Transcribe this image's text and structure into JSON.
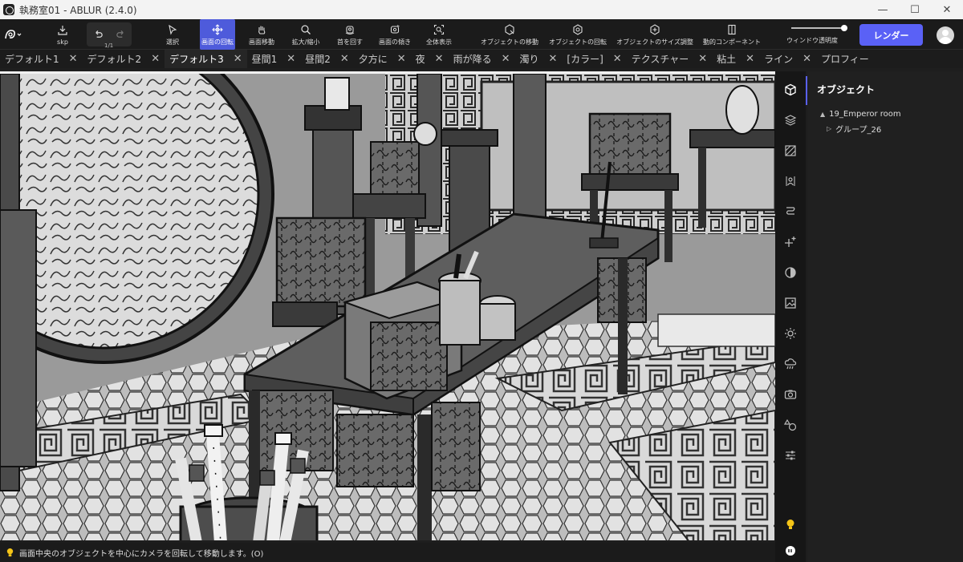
{
  "window": {
    "title": "執務室01 - ABLUR (2.4.0)",
    "controls": [
      "—",
      "☐",
      "✕"
    ]
  },
  "toolbar": {
    "file": {
      "label": "skp",
      "sub": "1/1"
    },
    "tools": [
      {
        "key": "select",
        "label": "選択",
        "icon": "cursor-icon"
      },
      {
        "key": "rotate",
        "label": "画面の回転",
        "icon": "orbit-icon",
        "active": true
      },
      {
        "key": "pan",
        "label": "画面移動",
        "icon": "hand-icon"
      },
      {
        "key": "zoom",
        "label": "拡大/縮小",
        "icon": "magnifier-icon"
      },
      {
        "key": "lookaround",
        "label": "首を回す",
        "icon": "head-turn-icon"
      },
      {
        "key": "tilt",
        "label": "画面の傾き",
        "icon": "tilt-icon"
      },
      {
        "key": "fit",
        "label": "全体表示",
        "icon": "fit-view-icon"
      },
      {
        "key": "objmove",
        "label": "オブジェクトの移動",
        "icon": "object-move-icon"
      },
      {
        "key": "objrotate",
        "label": "オブジェクトの回転",
        "icon": "object-rotate-icon"
      },
      {
        "key": "objscale",
        "label": "オブジェクトのサイズ調整",
        "icon": "object-scale-icon"
      },
      {
        "key": "dynamic",
        "label": "動的コンポーネント",
        "icon": "door-icon"
      }
    ],
    "opacity": {
      "label": "ウィンドウ透明度",
      "value": 1.0
    },
    "render_label": "レンダー"
  },
  "tabs": [
    {
      "label": "デフォルト1"
    },
    {
      "label": "デフォルト2"
    },
    {
      "label": "デフォルト3",
      "active": true
    },
    {
      "label": "昼間1"
    },
    {
      "label": "昼間2"
    },
    {
      "label": "夕方に"
    },
    {
      "label": "夜"
    },
    {
      "label": "雨が降る"
    },
    {
      "label": "濁り"
    },
    {
      "label": "[カラー]"
    },
    {
      "label": "テクスチャー"
    },
    {
      "label": "粘土"
    },
    {
      "label": "ライン"
    },
    {
      "label": "プロフィー"
    }
  ],
  "tab_close": "✕",
  "status": {
    "text": "画面中央のオブジェクトを中心にカメラを回転して移動します。(O)",
    "icon": "lightbulb-icon"
  },
  "side_icons": [
    "cube-icon",
    "layers-icon",
    "hatch-icon",
    "person-icon",
    "path-icon",
    "sparkle-icon",
    "contrast-icon",
    "image-icon",
    "sun-icon",
    "rain-icon",
    "camera-icon",
    "shapes-icon",
    "sliders-icon"
  ],
  "side_bottom_icons": [
    "idea-bulb-icon",
    "chat-icon"
  ],
  "panel": {
    "title": "オブジェクト",
    "tree": [
      {
        "label": "19_Emperor room",
        "expanded": true,
        "depth": 0
      },
      {
        "label": "グループ_26",
        "expanded": false,
        "depth": 1
      }
    ]
  },
  "colors": {
    "accent": "#5a61f6",
    "bulb": "#f5c518"
  }
}
